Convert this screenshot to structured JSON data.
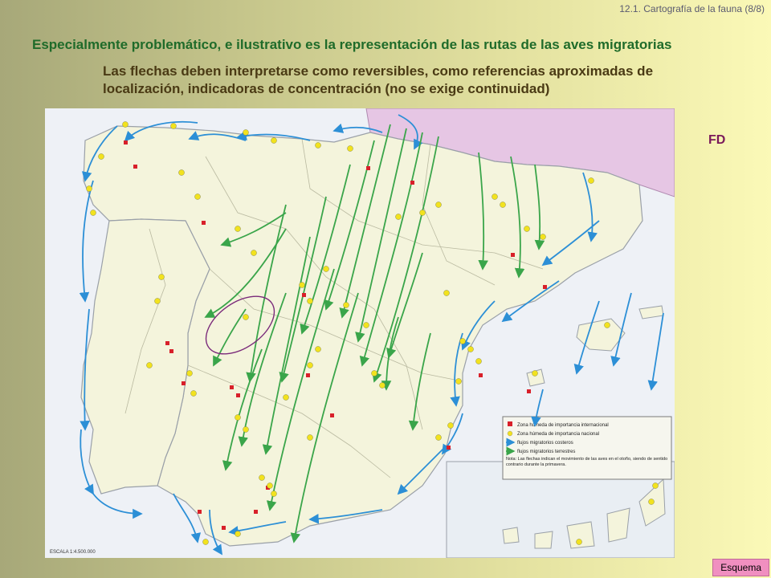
{
  "slide": {
    "section_ref": "12.1. Cartografía de la fauna (8/8)",
    "title": "Especialmente problemático, e ilustrativo es la representación de las rutas de las aves migratorias",
    "subtitle": "Las flechas deben interpretarse como reversibles, como referencias aproximadas de localización, indicadoras de concentración (no se exige continuidad)",
    "fd_label": "FD",
    "nav_button": "Esquema"
  },
  "map": {
    "scale": "ESCALA 1:4.500.000",
    "legend": {
      "items": [
        {
          "label": "Zona húmeda de importancia internacional",
          "symbol": "red-square",
          "color": "#d8202a"
        },
        {
          "label": "Zona húmeda de importancia nacional",
          "symbol": "yellow-circle",
          "color": "#f2e21e"
        },
        {
          "label": "flujos migratorios costeros",
          "symbol": "blue-arrow",
          "color": "#2c8fd6"
        },
        {
          "label": "flujos migratorios terrestres",
          "symbol": "green-arrow",
          "color": "#3aa54a"
        }
      ],
      "note": "Nota: Las flechas indican el movimiento de las aves en el otoño, siendo de sentido contrario durante la primavera."
    },
    "colors": {
      "sea": "#eef1f6",
      "spain": "#f4f4dc",
      "portugal": "#f4f4dc",
      "france": "#e6c6e4",
      "coastal_flow": "#2c8fd6",
      "inland_flow": "#3aa54a",
      "highlight_ellipse": "#7a2a7a"
    }
  }
}
